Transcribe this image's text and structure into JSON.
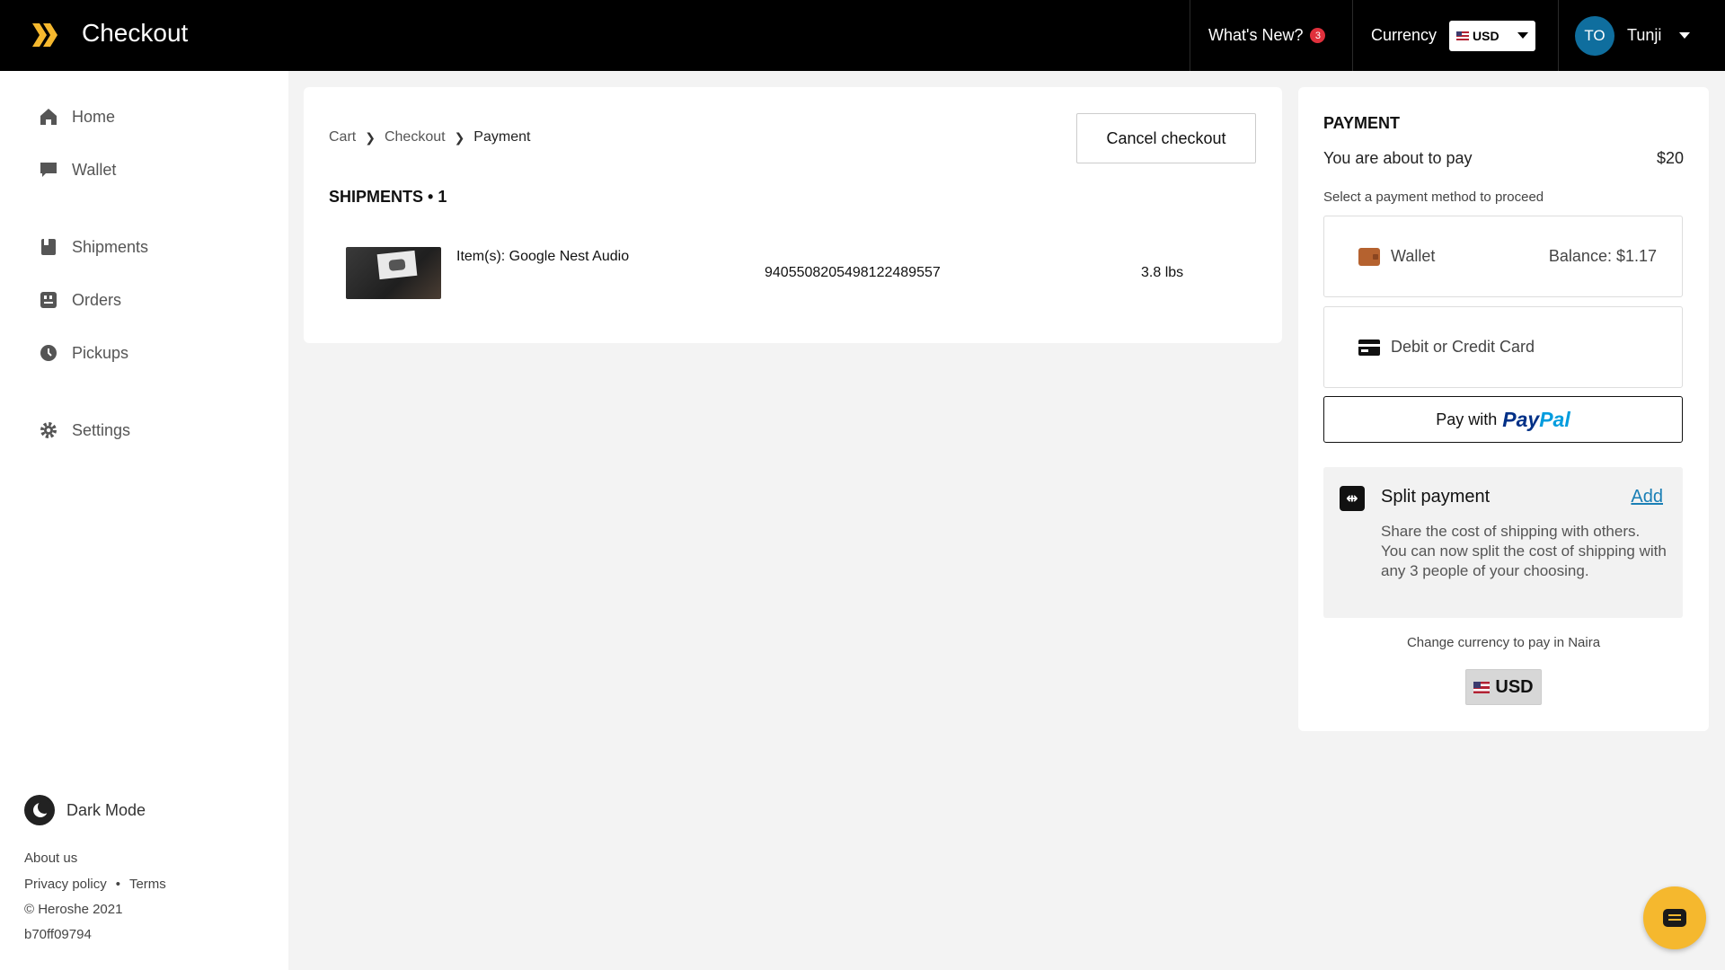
{
  "header": {
    "title": "Checkout",
    "whats_new_label": "What's New?",
    "whats_new_count": "3",
    "currency_label": "Currency",
    "currency_value": "USD",
    "user_initials": "TO",
    "user_name": "Tunji"
  },
  "sidebar": {
    "items": [
      {
        "label": "Home",
        "icon": "home-icon"
      },
      {
        "label": "Wallet",
        "icon": "wallet-icon"
      },
      {
        "label": "Shipments",
        "icon": "shipments-icon"
      },
      {
        "label": "Orders",
        "icon": "orders-icon"
      },
      {
        "label": "Pickups",
        "icon": "clock-icon"
      },
      {
        "label": "Settings",
        "icon": "gear-icon"
      }
    ],
    "dark_mode_label": "Dark Mode",
    "footer": {
      "about": "About us",
      "privacy": "Privacy policy",
      "dot": "•",
      "terms": "Terms",
      "copyright": "© Heroshe 2021",
      "build": "b70ff09794"
    }
  },
  "main": {
    "breadcrumb": [
      "Cart",
      "Checkout",
      "Payment"
    ],
    "cancel_label": "Cancel checkout",
    "shipments_heading": "SHIPMENTS • 1",
    "shipments": [
      {
        "items": "Item(s): Google Nest Audio",
        "tracking": "9405508205498122489557",
        "weight": "3.8 lbs"
      }
    ]
  },
  "payment": {
    "title": "PAYMENT",
    "about_label": "You are about to pay",
    "amount": "$20",
    "select_hint": "Select a payment method to proceed",
    "wallet_label": "Wallet",
    "wallet_balance": "Balance: $1.17",
    "card_label": "Debit or Credit Card",
    "paypal_prefix": "Pay with",
    "paypal_pay": "Pay",
    "paypal_pal": "Pal",
    "split_title": "Split payment",
    "split_add": "Add",
    "split_desc": "Share the cost of shipping with others. You can now split the cost of shipping with any 3 people of your choosing.",
    "change_currency": "Change currency to pay in Naira",
    "currency_button": "USD"
  },
  "colors": {
    "accent_yellow": "#f5b82e",
    "link_blue": "#1a7fb5",
    "avatar_blue": "#0f6e9e",
    "badge_red": "#e0303c"
  }
}
